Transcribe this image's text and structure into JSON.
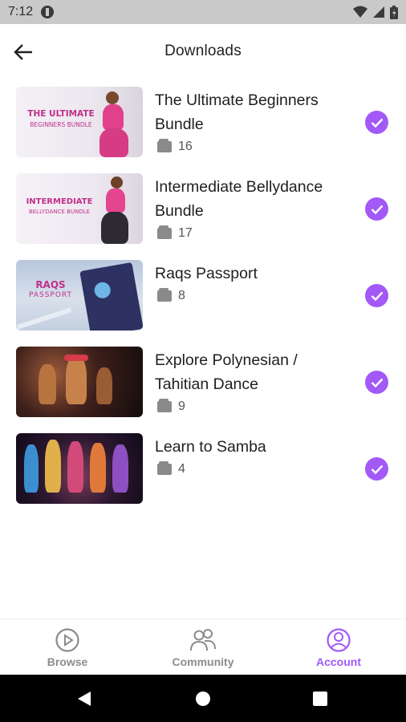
{
  "status_bar": {
    "time": "7:12"
  },
  "header": {
    "title": "Downloads"
  },
  "downloads": [
    {
      "title": "The Ultimate Beginners Bundle",
      "count": "16",
      "thumb_line1": "THE ULTIMATE",
      "thumb_line2": "BEGINNERS BUNDLE"
    },
    {
      "title": " Intermediate Bellydance Bundle",
      "count": "17",
      "thumb_line1": "INTERMEDIATE",
      "thumb_line2": "BELLYDANCE BUNDLE"
    },
    {
      "title": "Raqs Passport",
      "count": "8",
      "thumb_line1": "RAQS",
      "thumb_line2": "PASSPORT"
    },
    {
      "title": "Explore Polynesian / Tahitian Dance",
      "count": "9"
    },
    {
      "title": "Learn to Samba",
      "count": "4"
    }
  ],
  "bottom_nav": {
    "items": [
      {
        "label": "Browse",
        "icon": "play-circle-icon"
      },
      {
        "label": "Community",
        "icon": "people-icon"
      },
      {
        "label": "Account",
        "icon": "account-circle-icon",
        "active": true
      }
    ]
  },
  "colors": {
    "accent": "#a259f7",
    "inactive": "#8c8c8c",
    "status_bar": "#c9c9c9"
  }
}
